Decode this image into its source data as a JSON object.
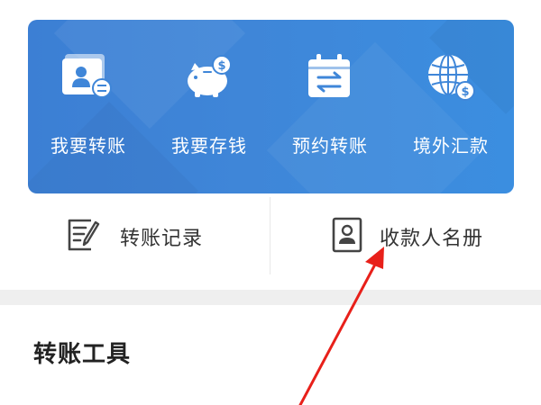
{
  "colors": {
    "banner_blue": "#3f86d8",
    "icon_white": "#ffffff",
    "icon_blue_accent": "#3f86d8",
    "shortcut_icon": "#444444",
    "divider": "#e8e8e8",
    "gap_band": "#efefef",
    "annotation_arrow": "#e8201a"
  },
  "quick_actions": [
    {
      "label": "我要转账",
      "icon": "transfer-card-icon"
    },
    {
      "label": "我要存钱",
      "icon": "piggy-bank-icon"
    },
    {
      "label": "预约转账",
      "icon": "calendar-transfer-icon"
    },
    {
      "label": "境外汇款",
      "icon": "globe-dollar-icon"
    }
  ],
  "shortcuts": [
    {
      "label": "转账记录",
      "icon": "edit-document-icon"
    },
    {
      "label": "收款人名册",
      "icon": "contact-book-icon"
    }
  ],
  "section": {
    "title": "转账工具"
  }
}
